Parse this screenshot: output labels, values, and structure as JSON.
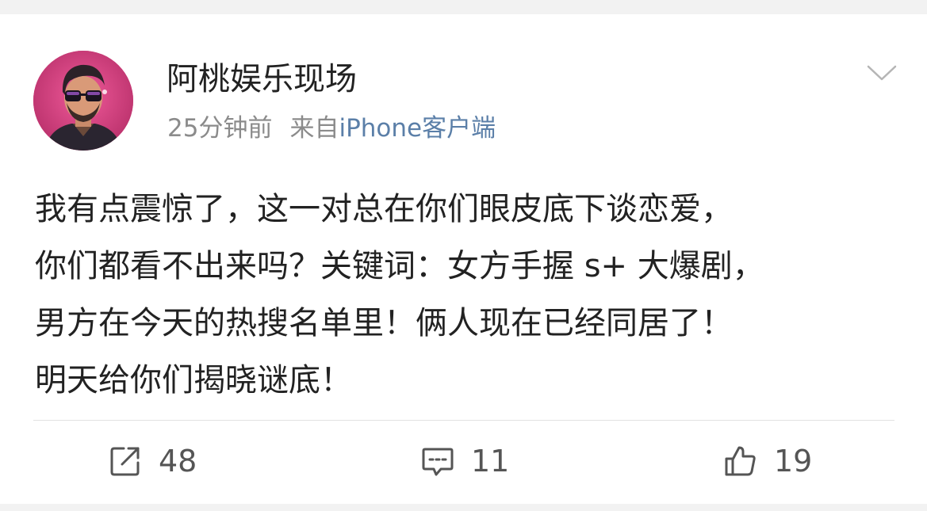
{
  "post": {
    "author": "阿桃娱乐现场",
    "time": "25分钟前",
    "source_prefix": "来自",
    "source_client": "iPhone客户端",
    "content_lines": [
      "我有点震惊了，这一对总在你们眼皮底下谈恋爱，",
      "你们都看不出来吗？关键词：女方手握 s+ 大爆剧，",
      "男方在今天的热搜名单里！俩人现在已经同居了！",
      "明天给你们揭晓谜底！"
    ]
  },
  "actions": {
    "share_count": "48",
    "comment_count": "11",
    "like_count": "19"
  },
  "icons": {
    "avatar": "cartoon-man-sunglasses-avatar",
    "menu": "chevron-down-icon",
    "share": "share-icon",
    "comment": "comment-icon",
    "like": "thumbs-up-icon"
  },
  "colors": {
    "link": "#5b7fa8",
    "avatar_bg": "#d8417e"
  }
}
